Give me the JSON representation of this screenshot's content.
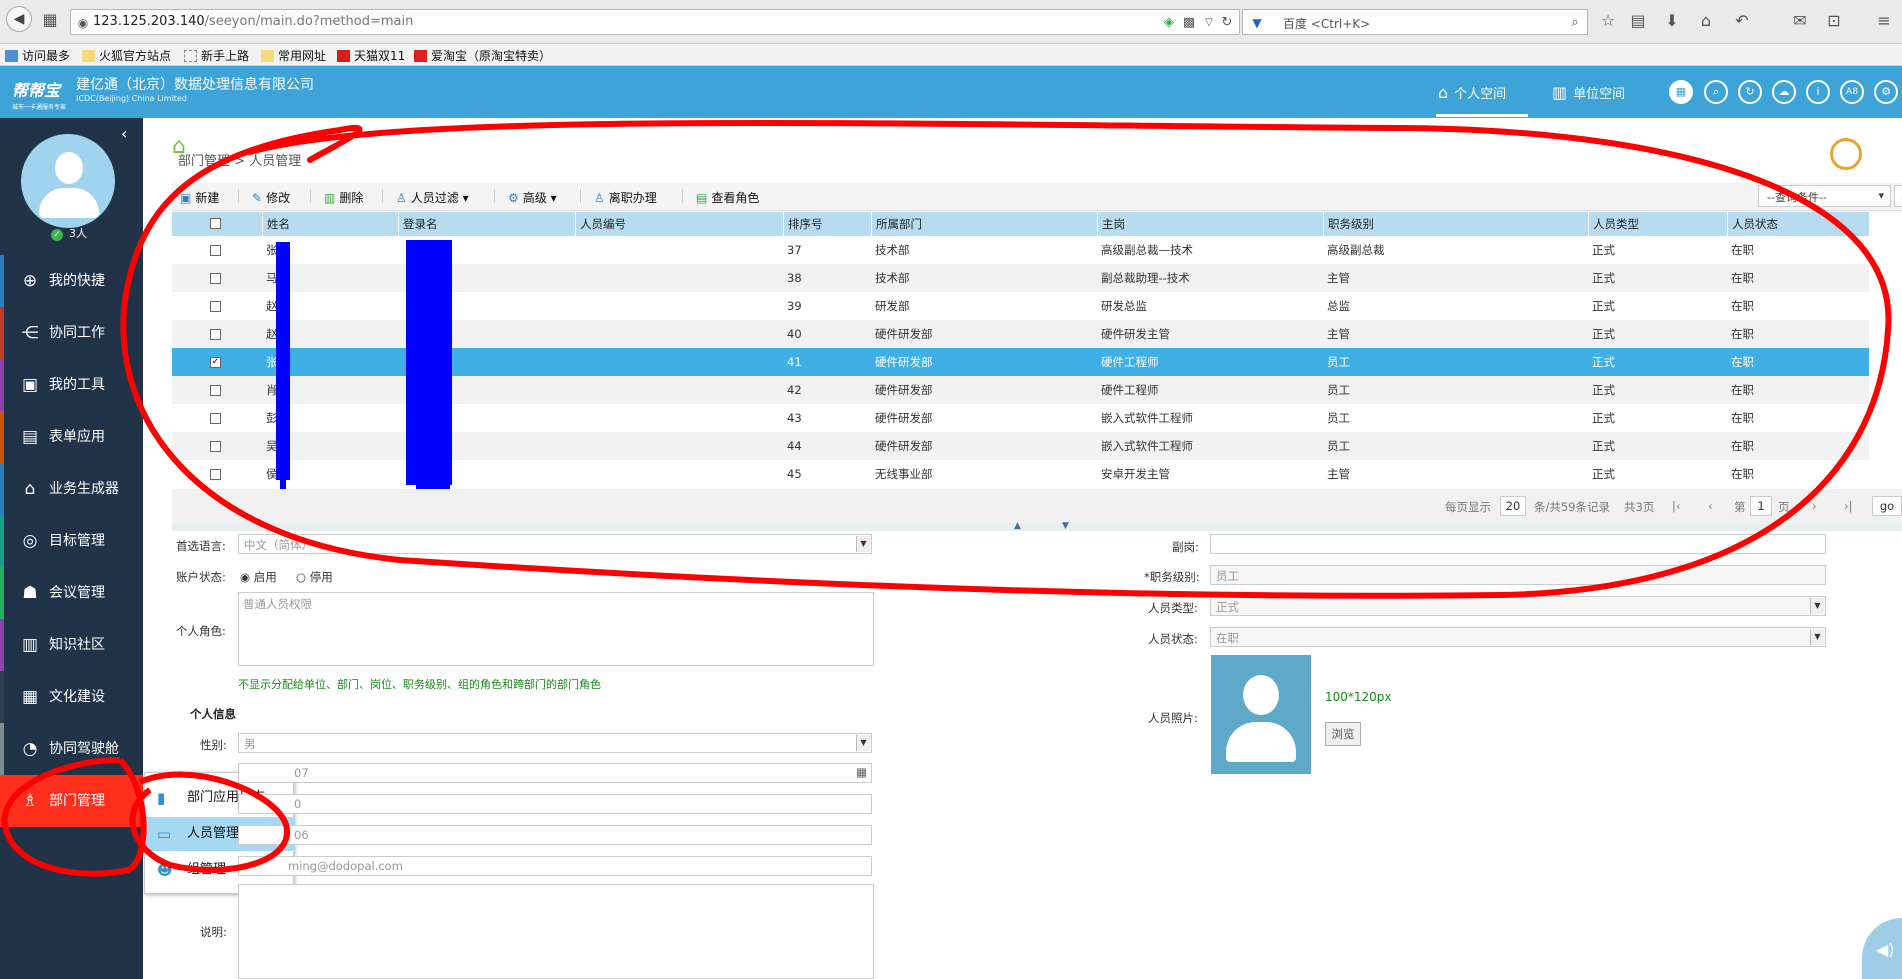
{
  "browser": {
    "url_host": "123.125.203.140",
    "url_path": "/seeyon/main.do?method=main",
    "search_placeholder": "百度 <Ctrl+K>",
    "bookmarks": [
      "访问最多",
      "火狐官方站点",
      "新手上路",
      "常用网址",
      "天猫双11",
      "爱淘宝（原淘宝特卖）"
    ]
  },
  "header": {
    "logo_text": "帮帮宝",
    "logo_sub": "城市一卡通服务专家",
    "company_cn": "建亿通（北京）数据处理信息有限公司",
    "company_en": "ICDC(Beijing) China Limited",
    "nav_personal": "个人空间",
    "nav_unit": "单位空间",
    "icon_a8": "A8"
  },
  "sidebar": {
    "online_count": "3人",
    "items": [
      {
        "label": "我的快捷",
        "icon": "plus-circle-icon",
        "glyph": "⊕"
      },
      {
        "label": "协同工作",
        "icon": "share-icon",
        "glyph": "⋲"
      },
      {
        "label": "我的工具",
        "icon": "toolbox-icon",
        "glyph": "▣"
      },
      {
        "label": "表单应用",
        "icon": "form-icon",
        "glyph": "▤"
      },
      {
        "label": "业务生成器",
        "icon": "house-icon",
        "glyph": "⌂"
      },
      {
        "label": "目标管理",
        "icon": "target-icon",
        "glyph": "◎"
      },
      {
        "label": "会议管理",
        "icon": "meeting-icon",
        "glyph": "☗"
      },
      {
        "label": "知识社区",
        "icon": "book-icon",
        "glyph": "▥"
      },
      {
        "label": "文化建设",
        "icon": "building-icon",
        "glyph": "▦"
      },
      {
        "label": "协同驾驶舱",
        "icon": "gauge-icon",
        "glyph": "◔"
      },
      {
        "label": "部门管理",
        "icon": "org-chart-icon",
        "glyph": "♗"
      }
    ]
  },
  "popup": {
    "items": [
      "部门应用日志",
      "人员管理",
      "组管理"
    ]
  },
  "breadcrumb": {
    "parent": "部门管理",
    "sep": ">",
    "current": "人员管理"
  },
  "toolbar": {
    "new": "新建",
    "edit": "修改",
    "delete": "删除",
    "filter": "人员过滤",
    "advanced": "高级",
    "resign": "离职办理",
    "view_role": "查看角色",
    "query_placeholder": "--查询条件--"
  },
  "grid": {
    "columns": [
      "姓名",
      "登录名",
      "人员编号",
      "排序号",
      "所属部门",
      "主岗",
      "职务级别",
      "人员类型",
      "人员状态"
    ],
    "rows": [
      {
        "checked": false,
        "name": "张",
        "sort": "37",
        "dept": "技术部",
        "post": "高级副总裁—技术",
        "level": "高级副总裁",
        "type": "正式",
        "status": "在职"
      },
      {
        "checked": false,
        "name": "马",
        "sort": "38",
        "dept": "技术部",
        "post": "副总裁助理--技术",
        "level": "主管",
        "type": "正式",
        "status": "在职"
      },
      {
        "checked": false,
        "name": "赵",
        "sort": "39",
        "dept": "研发部",
        "post": "研发总监",
        "level": "总监",
        "type": "正式",
        "status": "在职"
      },
      {
        "checked": false,
        "name": "赵",
        "sort": "40",
        "dept": "硬件研发部",
        "post": "硬件研发主管",
        "level": "主管",
        "type": "正式",
        "status": "在职"
      },
      {
        "checked": true,
        "name": "张",
        "sort": "41",
        "dept": "硬件研发部",
        "post": "硬件工程师",
        "level": "员工",
        "type": "正式",
        "status": "在职"
      },
      {
        "checked": false,
        "name": "肖",
        "sort": "42",
        "dept": "硬件研发部",
        "post": "硬件工程师",
        "level": "员工",
        "type": "正式",
        "status": "在职"
      },
      {
        "checked": false,
        "name": "彭",
        "sort": "43",
        "dept": "硬件研发部",
        "post": "嵌入式软件工程师",
        "level": "员工",
        "type": "正式",
        "status": "在职"
      },
      {
        "checked": false,
        "name": "吴",
        "sort": "44",
        "dept": "硬件研发部",
        "post": "嵌入式软件工程师",
        "level": "员工",
        "type": "正式",
        "status": "在职"
      },
      {
        "checked": false,
        "name": "侯",
        "sort": "45",
        "dept": "无线事业部",
        "post": "安卓开发主管",
        "level": "主管",
        "type": "正式",
        "status": "在职"
      }
    ]
  },
  "pager": {
    "per_page_label": "每页显示",
    "per_page": "20",
    "summary": "条/共59条记录",
    "total_pages": "共3页",
    "page_label": "第",
    "page": "1",
    "page_suffix": "页",
    "go": "go"
  },
  "form": {
    "lang_label": "首选语言:",
    "lang_value": "中文（简体）",
    "account_label": "账户状态:",
    "enable": "启用",
    "disable": "停用",
    "role_label": "个人角色:",
    "role_value": "普通人员权限",
    "hint": "不显示分配给单位、部门、岗位、职务级别、组的角色和跨部门的部门角色",
    "section": "个人信息",
    "gender_label": "性别:",
    "gender_value": "男",
    "birthday_partial": "07",
    "phone_partial": "0",
    "mobile_partial": "06",
    "email_partial": "ming@dodopal.com",
    "desc_label": "说明:",
    "deputy_label": "副岗:",
    "level_label": "*职务级别:",
    "level_value": "员工",
    "type_label": "人员类型:",
    "type_value": "正式",
    "status_label": "人员状态:",
    "status_value": "在职",
    "photo_label": "人员照片:",
    "photo_size": "100*120px",
    "browse": "浏览"
  }
}
